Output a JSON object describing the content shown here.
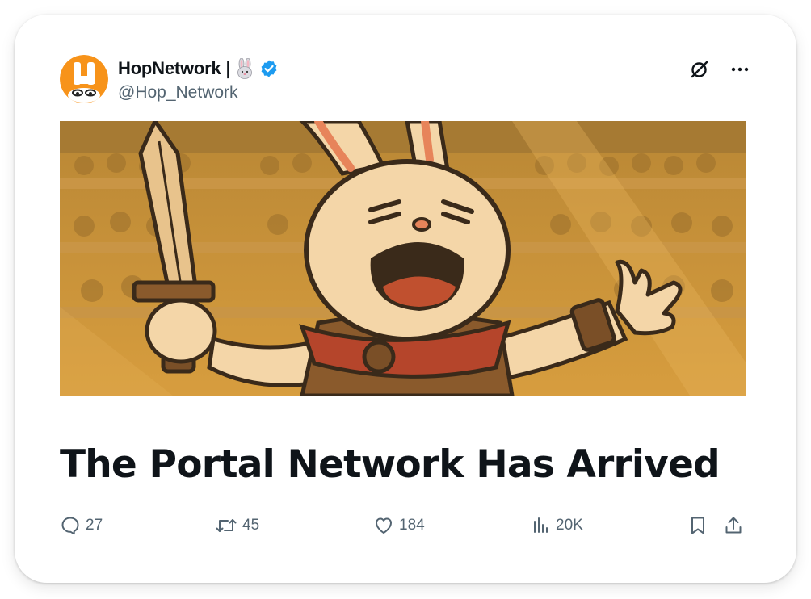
{
  "tweet": {
    "display_name": "HopNetwork |",
    "handle": "@Hop_Network",
    "title": "The Portal Network Has Arrived",
    "icons": {
      "name_emoji": "rabbit-face-icon",
      "verified": "verified-badge-icon",
      "grok": "grok-icon",
      "more": "more-icon"
    },
    "actions": {
      "replies": "27",
      "reposts": "45",
      "likes": "184",
      "views": "20K"
    },
    "colors": {
      "accent": "#1d9bf0",
      "text": "#0f1419",
      "secondary": "#536471",
      "avatar_orange": "#f7931a"
    }
  }
}
